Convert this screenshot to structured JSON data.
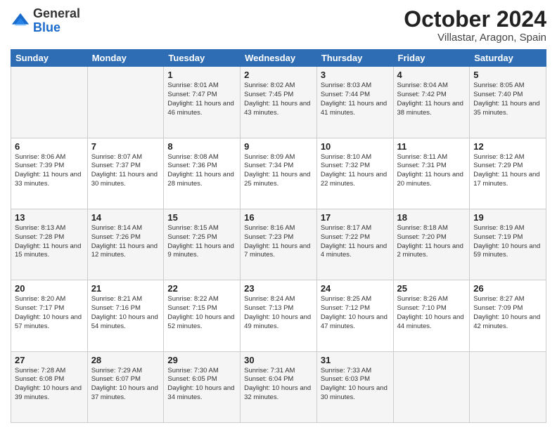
{
  "logo": {
    "general": "General",
    "blue": "Blue"
  },
  "title": "October 2024",
  "location": "Villastar, Aragon, Spain",
  "days_of_week": [
    "Sunday",
    "Monday",
    "Tuesday",
    "Wednesday",
    "Thursday",
    "Friday",
    "Saturday"
  ],
  "weeks": [
    [
      {
        "day": "",
        "info": ""
      },
      {
        "day": "",
        "info": ""
      },
      {
        "day": "1",
        "info": "Sunrise: 8:01 AM\nSunset: 7:47 PM\nDaylight: 11 hours and 46 minutes."
      },
      {
        "day": "2",
        "info": "Sunrise: 8:02 AM\nSunset: 7:45 PM\nDaylight: 11 hours and 43 minutes."
      },
      {
        "day": "3",
        "info": "Sunrise: 8:03 AM\nSunset: 7:44 PM\nDaylight: 11 hours and 41 minutes."
      },
      {
        "day": "4",
        "info": "Sunrise: 8:04 AM\nSunset: 7:42 PM\nDaylight: 11 hours and 38 minutes."
      },
      {
        "day": "5",
        "info": "Sunrise: 8:05 AM\nSunset: 7:40 PM\nDaylight: 11 hours and 35 minutes."
      }
    ],
    [
      {
        "day": "6",
        "info": "Sunrise: 8:06 AM\nSunset: 7:39 PM\nDaylight: 11 hours and 33 minutes."
      },
      {
        "day": "7",
        "info": "Sunrise: 8:07 AM\nSunset: 7:37 PM\nDaylight: 11 hours and 30 minutes."
      },
      {
        "day": "8",
        "info": "Sunrise: 8:08 AM\nSunset: 7:36 PM\nDaylight: 11 hours and 28 minutes."
      },
      {
        "day": "9",
        "info": "Sunrise: 8:09 AM\nSunset: 7:34 PM\nDaylight: 11 hours and 25 minutes."
      },
      {
        "day": "10",
        "info": "Sunrise: 8:10 AM\nSunset: 7:32 PM\nDaylight: 11 hours and 22 minutes."
      },
      {
        "day": "11",
        "info": "Sunrise: 8:11 AM\nSunset: 7:31 PM\nDaylight: 11 hours and 20 minutes."
      },
      {
        "day": "12",
        "info": "Sunrise: 8:12 AM\nSunset: 7:29 PM\nDaylight: 11 hours and 17 minutes."
      }
    ],
    [
      {
        "day": "13",
        "info": "Sunrise: 8:13 AM\nSunset: 7:28 PM\nDaylight: 11 hours and 15 minutes."
      },
      {
        "day": "14",
        "info": "Sunrise: 8:14 AM\nSunset: 7:26 PM\nDaylight: 11 hours and 12 minutes."
      },
      {
        "day": "15",
        "info": "Sunrise: 8:15 AM\nSunset: 7:25 PM\nDaylight: 11 hours and 9 minutes."
      },
      {
        "day": "16",
        "info": "Sunrise: 8:16 AM\nSunset: 7:23 PM\nDaylight: 11 hours and 7 minutes."
      },
      {
        "day": "17",
        "info": "Sunrise: 8:17 AM\nSunset: 7:22 PM\nDaylight: 11 hours and 4 minutes."
      },
      {
        "day": "18",
        "info": "Sunrise: 8:18 AM\nSunset: 7:20 PM\nDaylight: 11 hours and 2 minutes."
      },
      {
        "day": "19",
        "info": "Sunrise: 8:19 AM\nSunset: 7:19 PM\nDaylight: 10 hours and 59 minutes."
      }
    ],
    [
      {
        "day": "20",
        "info": "Sunrise: 8:20 AM\nSunset: 7:17 PM\nDaylight: 10 hours and 57 minutes."
      },
      {
        "day": "21",
        "info": "Sunrise: 8:21 AM\nSunset: 7:16 PM\nDaylight: 10 hours and 54 minutes."
      },
      {
        "day": "22",
        "info": "Sunrise: 8:22 AM\nSunset: 7:15 PM\nDaylight: 10 hours and 52 minutes."
      },
      {
        "day": "23",
        "info": "Sunrise: 8:24 AM\nSunset: 7:13 PM\nDaylight: 10 hours and 49 minutes."
      },
      {
        "day": "24",
        "info": "Sunrise: 8:25 AM\nSunset: 7:12 PM\nDaylight: 10 hours and 47 minutes."
      },
      {
        "day": "25",
        "info": "Sunrise: 8:26 AM\nSunset: 7:10 PM\nDaylight: 10 hours and 44 minutes."
      },
      {
        "day": "26",
        "info": "Sunrise: 8:27 AM\nSunset: 7:09 PM\nDaylight: 10 hours and 42 minutes."
      }
    ],
    [
      {
        "day": "27",
        "info": "Sunrise: 7:28 AM\nSunset: 6:08 PM\nDaylight: 10 hours and 39 minutes."
      },
      {
        "day": "28",
        "info": "Sunrise: 7:29 AM\nSunset: 6:07 PM\nDaylight: 10 hours and 37 minutes."
      },
      {
        "day": "29",
        "info": "Sunrise: 7:30 AM\nSunset: 6:05 PM\nDaylight: 10 hours and 34 minutes."
      },
      {
        "day": "30",
        "info": "Sunrise: 7:31 AM\nSunset: 6:04 PM\nDaylight: 10 hours and 32 minutes."
      },
      {
        "day": "31",
        "info": "Sunrise: 7:33 AM\nSunset: 6:03 PM\nDaylight: 10 hours and 30 minutes."
      },
      {
        "day": "",
        "info": ""
      },
      {
        "day": "",
        "info": ""
      }
    ]
  ]
}
